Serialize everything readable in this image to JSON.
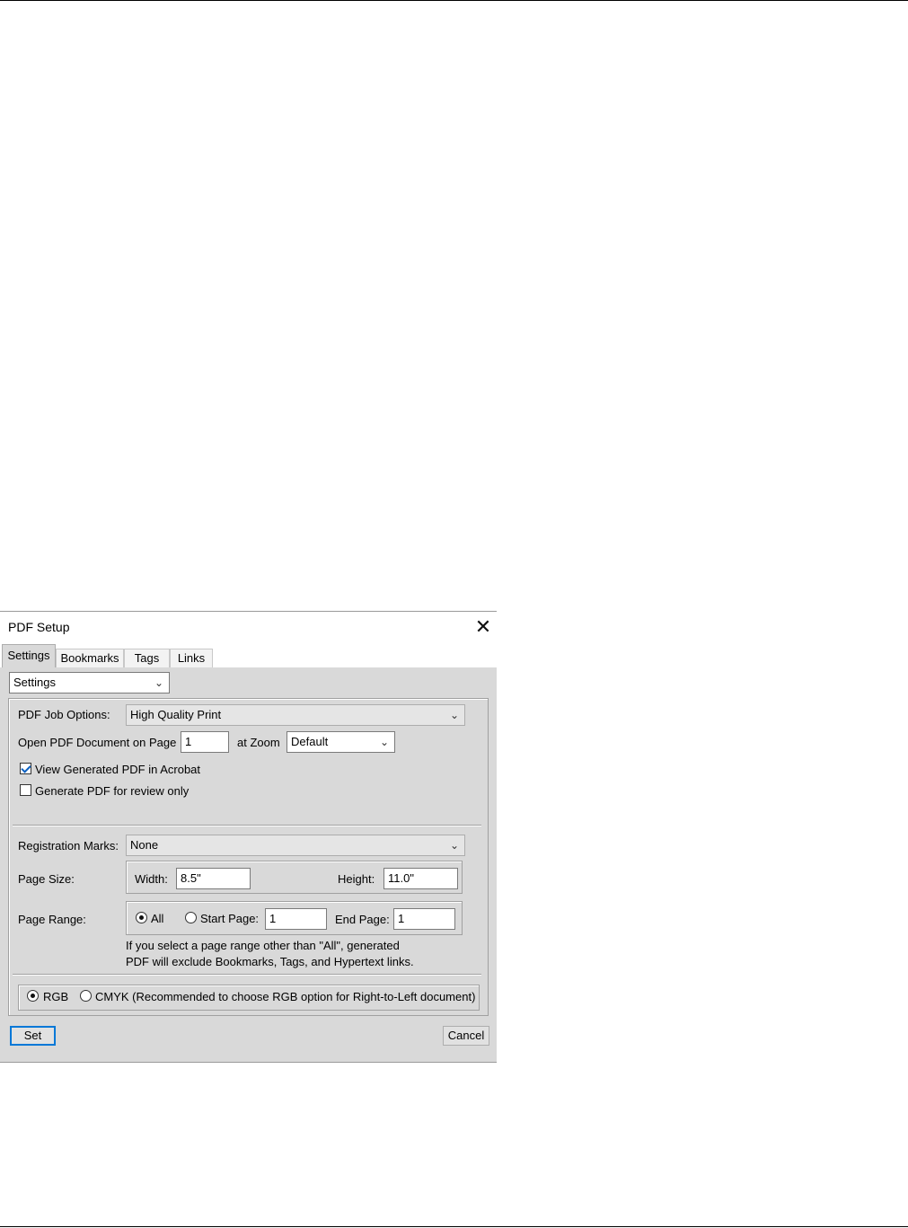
{
  "dialog": {
    "title": "PDF Setup",
    "close_glyph": "✕",
    "tabs": [
      {
        "label": "Settings",
        "active": true
      },
      {
        "label": "Bookmarks",
        "active": false
      },
      {
        "label": "Tags",
        "active": false
      },
      {
        "label": "Links",
        "active": false
      }
    ],
    "settings_combo": {
      "value": "Settings"
    },
    "job_options": {
      "label": "PDF Job Options:",
      "value": "High Quality Print"
    },
    "open_page": {
      "label": "Open PDF Document on Page",
      "value": "1",
      "zoom_label": "at Zoom",
      "zoom_value": "Default"
    },
    "view_in_acrobat": {
      "label": "View Generated PDF in Acrobat",
      "checked": true
    },
    "review_only": {
      "label": "Generate PDF for review only",
      "checked": false
    },
    "registration_marks": {
      "label": "Registration Marks:",
      "value": "None"
    },
    "page_size": {
      "label": "Page Size:",
      "width_label": "Width:",
      "width_value": "8.5\"",
      "height_label": "Height:",
      "height_value": "11.0\""
    },
    "page_range": {
      "label": "Page Range:",
      "all_label": "All",
      "start_label": "Start Page:",
      "start_value": "1",
      "end_label": "End Page:",
      "end_value": "1",
      "selected": "All",
      "note_line1": "If you select a page range other than \"All\",  generated",
      "note_line2": "PDF will exclude Bookmarks, Tags, and Hypertext links."
    },
    "color_mode": {
      "rgb_label": "RGB",
      "cmyk_label": "CMYK (Recommended to choose RGB option for Right-to-Left document)",
      "selected": "RGB"
    },
    "buttons": {
      "set": "Set",
      "cancel": "Cancel"
    }
  },
  "icons": {
    "chevron": "chevron-down-icon",
    "close": "close-icon"
  },
  "colors": {
    "dialog_bg": "#d9d9d9",
    "default_button_border": "#0078d7",
    "check_color": "#0a5fc0"
  }
}
